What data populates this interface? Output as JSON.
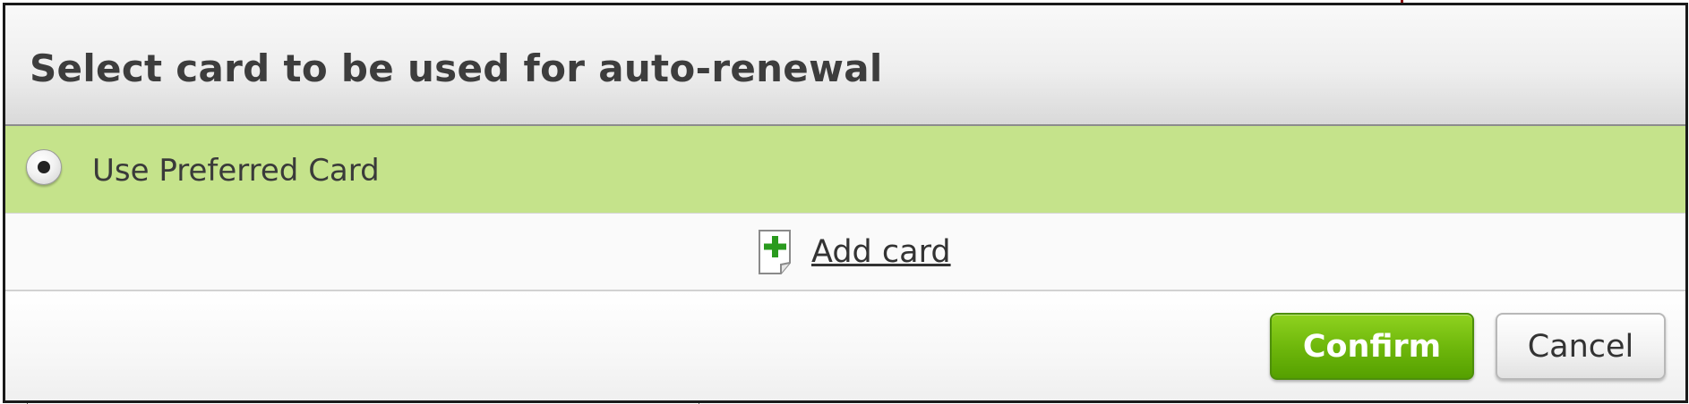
{
  "dialog": {
    "title": "Select card to be used for auto-renewal"
  },
  "options": {
    "preferred_card": {
      "label": "Use Preferred Card",
      "selected": true
    }
  },
  "add_card": {
    "label": "Add card",
    "icon": "add-document-icon"
  },
  "footer": {
    "confirm_label": "Confirm",
    "cancel_label": "Cancel"
  },
  "colors": {
    "selected_row": "#c5e38b",
    "confirm_button": "#6fb80c",
    "plus_icon": "#2a9a1e"
  }
}
